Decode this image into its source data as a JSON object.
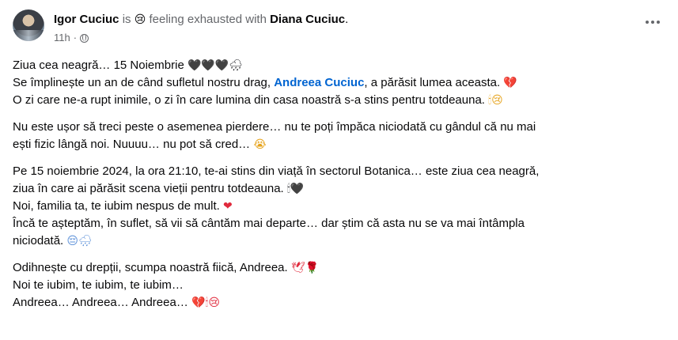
{
  "post": {
    "author": "Igor Cuciuc",
    "is_text": "is",
    "feeling_emoji": "😢",
    "feeling_text": "feeling exhausted with",
    "tagged": "Diana Cuciuc",
    "tagged_end": ".",
    "time": "11h",
    "dot": "·",
    "privacy_icon": "globe-icon",
    "more_icon": "more-options-icon"
  },
  "body": {
    "p1_l1_text": "Ziua cea neagră… 15 Noiembrie ",
    "p1_l1_emoji": "🖤🖤🖤🌧",
    "p1_l2_a": "Se împlinește un an de când sufletul nostru drag, ",
    "p1_l2_mention": "Andreea Cuciuc",
    "p1_l2_b": ", a părăsit lumea aceasta. ",
    "p1_l2_emoji": "💔",
    "p1_l3_text": "O zi care ne-a rupt inimile, o zi în care lumina din casa noastră s-a stins pentru totdeauna. ",
    "p1_l3_emoji": "🕯😢",
    "p2_l1_text": "Nu este ușor să treci peste o asemenea pierdere… nu te poți împăca niciodată cu gândul că nu mai",
    "p2_l2_text": "ești fizic lângă noi. Nuuuu… nu pot să cred… ",
    "p2_l2_emoji": "😭",
    "p3_l1_text": "Pe 15 noiembrie 2024, la ora 21:10, te-ai stins din viață în sectorul Botanica… este ziua cea neagră,",
    "p3_l2_text": "ziua în care ai părăsit scena vieții pentru totdeauna. ",
    "p3_l2_emoji": "🕯🖤",
    "p3_l3_text": "Noi, familia ta, te iubim nespus de mult. ",
    "p3_l3_emoji": "❤",
    "p3_l4_text": "Încă te așteptăm, în suflet, să vii să cântăm mai departe… dar știm că asta nu se va mai întâmpla",
    "p3_l5_text": "niciodată. ",
    "p3_l5_emoji": "😔🌧",
    "p4_l1_text": "Odihnește cu drepții, scumpa noastră fiică, Andreea. ",
    "p4_l1_emoji": "🕊🌹",
    "p4_l2_text": "Noi te iubim, te iubim, te iubim…",
    "p4_l3_text": "Andreea… Andreea… Andreea… ",
    "p4_l3_emoji": "💔🕯😢"
  },
  "colors": {
    "mention": "#0064d1",
    "muted": "#65676b",
    "text": "#080809"
  }
}
